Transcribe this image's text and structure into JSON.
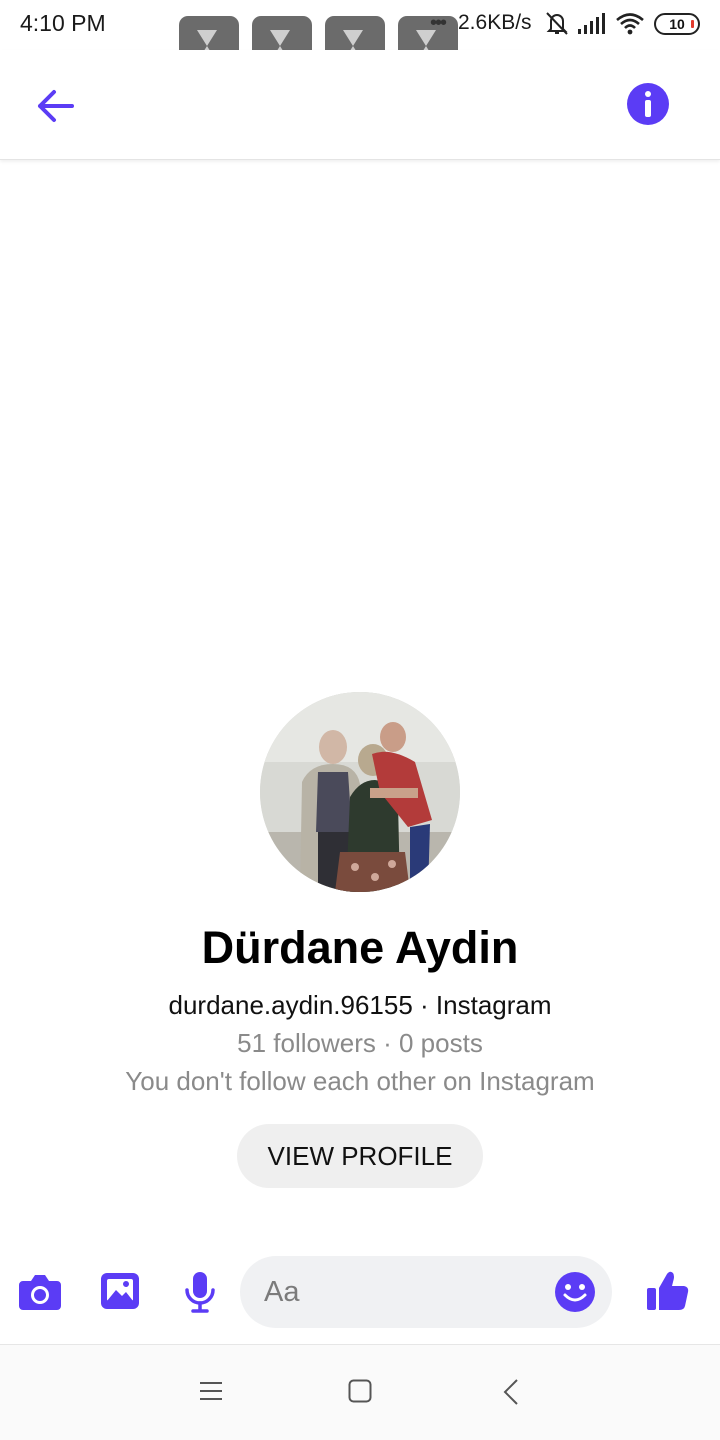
{
  "status_bar": {
    "time": "4:10 PM",
    "more": "•••",
    "speed": "2.6KB/s",
    "battery": "10",
    "icons": [
      "app-shortcut-icon",
      "mute-bell-icon",
      "signal-icon",
      "wifi-icon",
      "battery-icon"
    ]
  },
  "header": {
    "back_icon": "arrow-left-icon",
    "info_icon": "info-icon",
    "accent_color": "#5b3cf5"
  },
  "profile": {
    "name": "Dürdane Aydin",
    "handle_line": "durdane.aydin.96155 · Instagram",
    "stats_line": "51 followers · 0 posts",
    "follow_status": "You don't follow each other on Instagram",
    "view_profile_label": "VIEW PROFILE"
  },
  "composer": {
    "placeholder": "Aa",
    "icons": [
      "camera-icon",
      "gallery-icon",
      "microphone-icon",
      "emoji-icon",
      "thumbs-up-icon"
    ]
  },
  "nav": {
    "icons": [
      "menu-icon",
      "home-icon",
      "back-icon"
    ]
  }
}
